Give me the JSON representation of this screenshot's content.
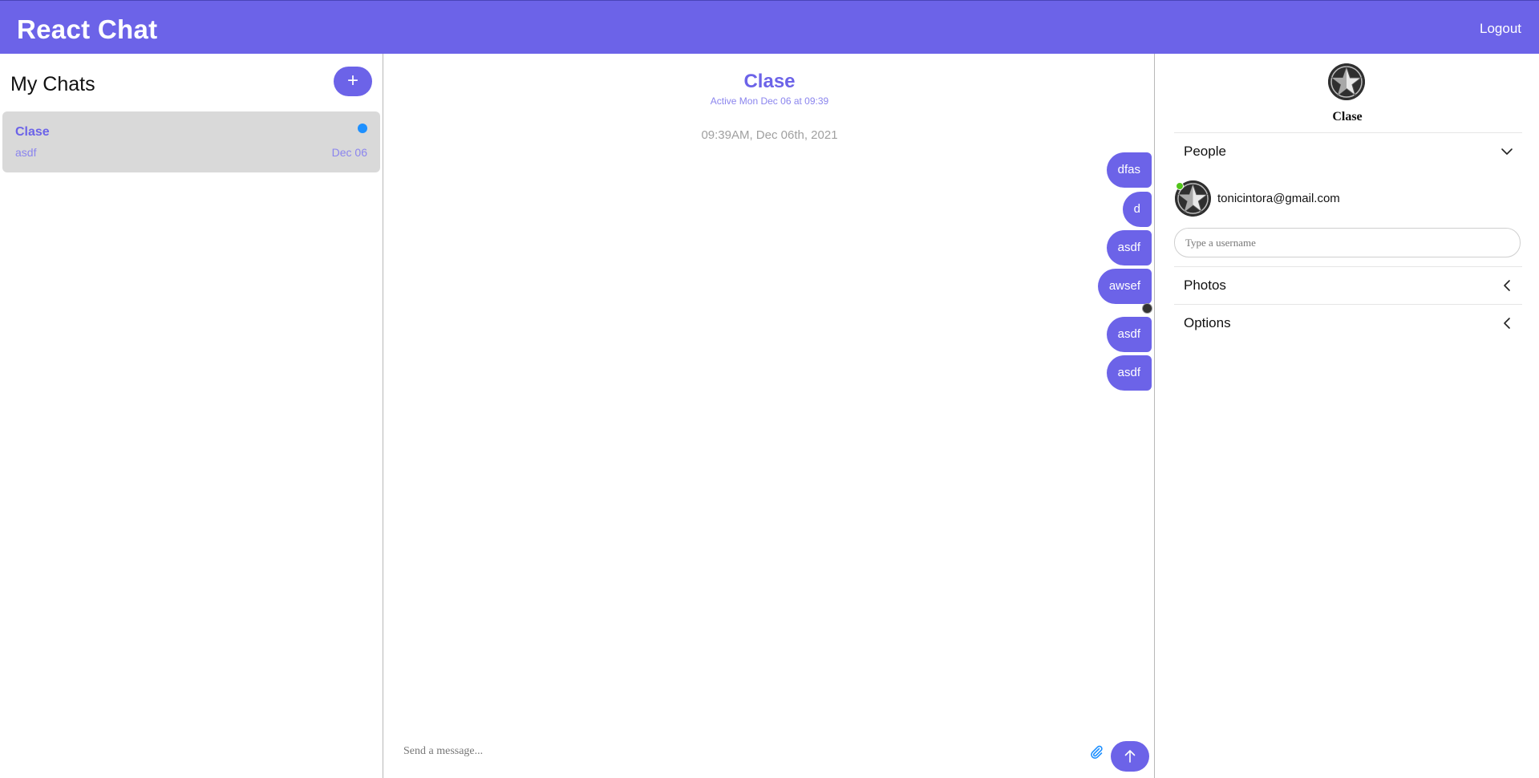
{
  "header": {
    "title": "React Chat",
    "logout_label": "Logout",
    "accent_color": "#6c63e8"
  },
  "chat_list": {
    "title": "My Chats",
    "new_chat_label": "+",
    "items": [
      {
        "title": "Clase",
        "last_message": "asdf",
        "date": "Dec 06",
        "unread": true
      }
    ]
  },
  "conversation": {
    "title": "Clase",
    "subtitle": "Active Mon Dec 06 at 09:39",
    "date_divider": "09:39AM, Dec 06th, 2021",
    "messages": [
      {
        "text": "dfas"
      },
      {
        "text": "d"
      },
      {
        "text": "asdf"
      },
      {
        "text": "awsef"
      },
      {
        "text": "asdf"
      },
      {
        "text": "asdf"
      }
    ],
    "composer_placeholder": "Send a message...",
    "attach_icon": "paperclip-icon",
    "send_icon": "arrow-up-icon"
  },
  "settings": {
    "chat_name": "Clase",
    "sections": {
      "people": {
        "label": "People",
        "expanded": true
      },
      "photos": {
        "label": "Photos",
        "expanded": false
      },
      "options": {
        "label": "Options",
        "expanded": false
      }
    },
    "people": [
      {
        "email": "tonicintora@gmail.com",
        "online": true
      }
    ],
    "username_placeholder": "Type a username"
  }
}
